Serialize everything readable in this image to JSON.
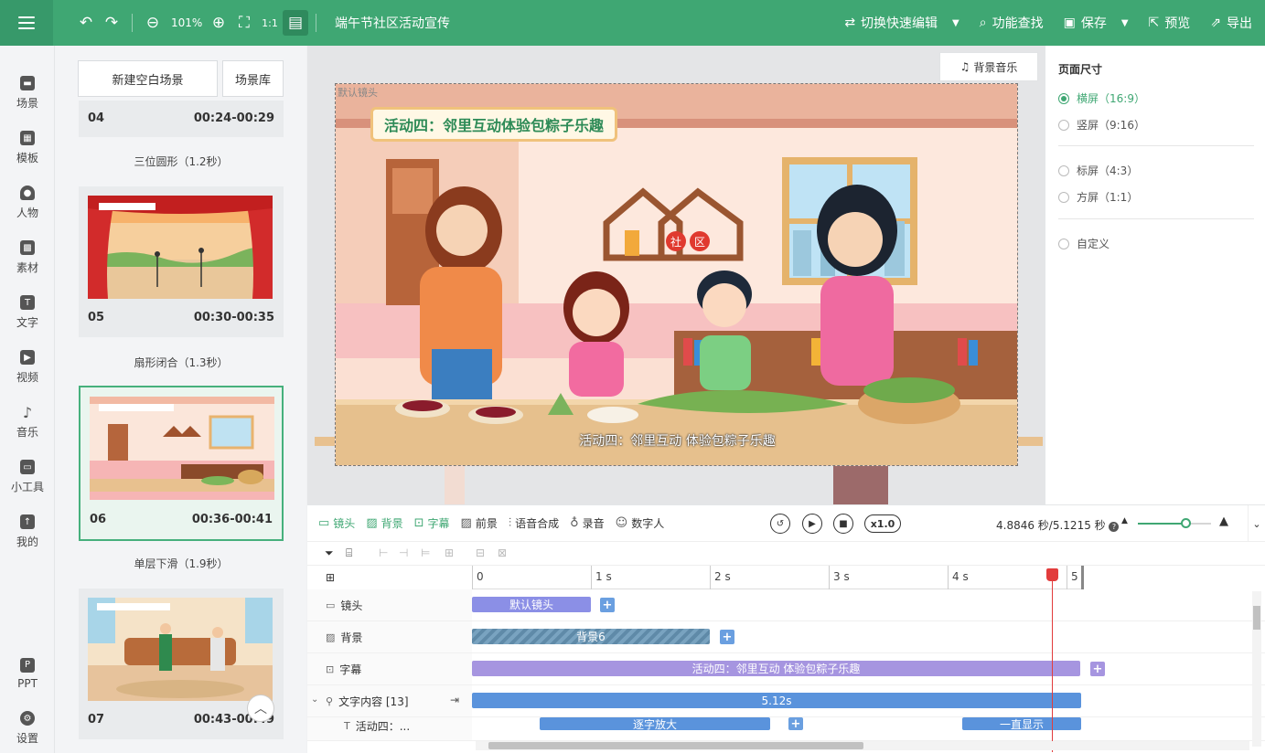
{
  "topbar": {
    "zoom": "101%",
    "doc_title": "端午节社区活动宣传",
    "switch_edit": "切换快速编辑",
    "feature_search": "功能查找",
    "save": "保存",
    "preview": "预览",
    "export": "导出"
  },
  "leftnav": [
    "场景",
    "模板",
    "人物",
    "素材",
    "文字",
    "视频",
    "音乐",
    "小工具",
    "我的",
    "PPT",
    "设置"
  ],
  "scenes": {
    "new_blank": "新建空白场景",
    "library": "场景库",
    "cards": [
      {
        "num": "04",
        "time": "00:24-00:29",
        "transition": "三位圆形（1.2秒）"
      },
      {
        "num": "05",
        "time": "00:30-00:35",
        "transition": "扇形闭合（1.3秒）"
      },
      {
        "num": "06",
        "time": "00:36-00:41",
        "transition": "单层下滑（1.9秒）"
      },
      {
        "num": "07",
        "time": "00:43-00:49"
      }
    ]
  },
  "canvas": {
    "bgm": "背景音乐",
    "camera_label": "默认镜头",
    "title": "活动四：邻里互动体验包粽子乐趣",
    "subtitle": "活动四：邻里互动 体验包粽子乐趣",
    "sign": [
      "社",
      "区"
    ]
  },
  "rightpanel": {
    "title": "页面尺寸",
    "options": [
      "横屏（16:9）",
      "竖屏（9:16）",
      "标屏（4:3）",
      "方屏（1:1）",
      "自定义"
    ]
  },
  "timeline": {
    "tabs": [
      "镜头",
      "背景",
      "字幕",
      "前景",
      "语音合成",
      "录音",
      "数字人"
    ],
    "speed": "x1.0",
    "time": "4.8846 秒/5.1215 秒",
    "ruler": [
      "0",
      "1 s",
      "2 s",
      "3 s",
      "4 s",
      "5"
    ],
    "rows": {
      "camera": {
        "label": "镜头",
        "clip": "默认镜头"
      },
      "background": {
        "label": "背景",
        "clip": "背景6"
      },
      "subtitle": {
        "label": "字幕",
        "clip": "活动四：邻里互动 体验包粽子乐趣"
      },
      "text": {
        "label": "文字内容 [13]",
        "clip": "5.12s"
      },
      "item": {
        "label": "活动四：...",
        "clip1": "逐字放大",
        "clip2": "一直显示"
      }
    }
  }
}
